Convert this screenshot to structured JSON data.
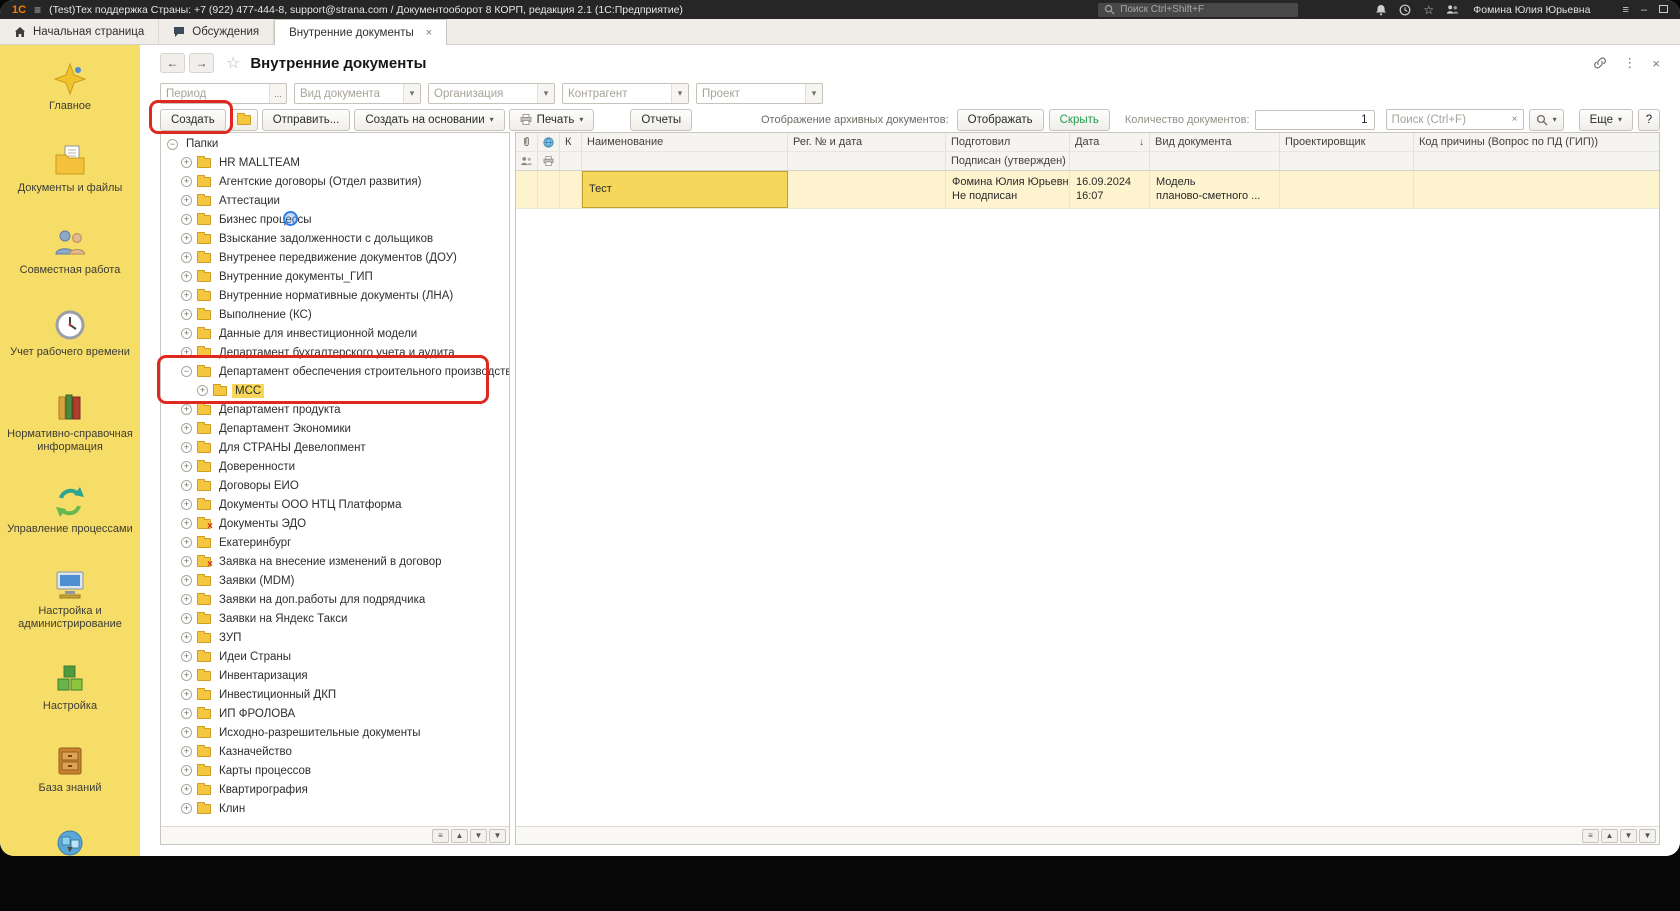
{
  "colors": {
    "annotation_red": "#E0281E",
    "selection_yellow": "#F6D75C",
    "row_highlight": "#FDF3CE",
    "hide_button_green": "#1E9E4B",
    "sidebar_gold": "#F6DD68"
  },
  "titlebar": {
    "logo": "1С",
    "title": "(Test)Тех поддержка Страны: +7 (922) 477-444-8, support@strana.com / Документооборот 8 КОРП, редакция 2.1  (1С:Предприятие)",
    "search_placeholder": "Поиск Ctrl+Shift+F",
    "user_name": "Фомина Юлия Юрьевна",
    "minimize": "–",
    "menu_glyph": "≡"
  },
  "tabbar": {
    "tabs": [
      {
        "label": "Начальная страница",
        "icon": "home-icon",
        "active": false
      },
      {
        "label": "Обсуждения",
        "icon": "chat-icon",
        "active": false
      },
      {
        "label": "Внутренние документы",
        "icon": null,
        "active": true,
        "close": "×"
      }
    ]
  },
  "sidebar": {
    "items": [
      {
        "label": "Главное",
        "icon": "main-icon"
      },
      {
        "label": "Документы и файлы",
        "icon": "documents-icon"
      },
      {
        "label": "Совместная работа",
        "icon": "collaboration-icon"
      },
      {
        "label": "Учет рабочего времени",
        "icon": "time-tracking-icon"
      },
      {
        "label": "Нормативно-справочная информация",
        "icon": "reference-info-icon"
      },
      {
        "label": "Управление процессами",
        "icon": "process-management-icon"
      },
      {
        "label": "Настройка и администрирование",
        "icon": "administration-icon"
      },
      {
        "label": "Настройка",
        "icon": "settings-icon"
      },
      {
        "label": "База знаний",
        "icon": "knowledge-base-icon"
      }
    ],
    "more_glyph": "▼"
  },
  "page": {
    "title": "Внутренние документы",
    "back_glyph": "←",
    "forward_glyph": "→",
    "star_glyph": "☆",
    "kebab_glyph": "⋮",
    "close_glyph": "×",
    "filters": {
      "period_placeholder": "Период",
      "period_button": "...",
      "doc_kind_placeholder": "Вид документа",
      "organization_placeholder": "Организация",
      "counterparty_placeholder": "Контрагент",
      "project_placeholder": "Проект",
      "dropdown_glyph": "▾"
    },
    "toolbar": {
      "create": "Создать",
      "send": "Отправить...",
      "create_based_on": "Создать на основании",
      "print": "Печать",
      "reports": "Отчеты",
      "caret": "▾",
      "archive_display_label": "Отображение архивных документов:",
      "show": "Отображать",
      "hide": "Скрыть",
      "doc_count_label": "Количество документов:",
      "doc_count_value": "1",
      "search_placeholder": "Поиск (Ctrl+F)",
      "clear_glyph": "×",
      "more": "Еще",
      "help": "?"
    }
  },
  "tree": {
    "root_label": "Папки",
    "root_expander": "−",
    "items": [
      {
        "label": "HR MALLTEAM",
        "exp": "+",
        "level": 1,
        "icon": "folder"
      },
      {
        "label": "Агентские договоры (Отдел развития)",
        "exp": "+",
        "level": 1,
        "icon": "folder"
      },
      {
        "label": "Аттестации",
        "exp": "+",
        "level": 1,
        "icon": "folder"
      },
      {
        "label": "Бизнес процессы",
        "exp": "+",
        "level": 1,
        "icon": "folder"
      },
      {
        "label": "Взыскание задолженности с дольщиков",
        "exp": "+",
        "level": 1,
        "icon": "folder"
      },
      {
        "label": "Внутренее передвижение документов (ДОУ)",
        "exp": "+",
        "level": 1,
        "icon": "folder"
      },
      {
        "label": "Внутренние документы_ГИП",
        "exp": "+",
        "level": 1,
        "icon": "folder"
      },
      {
        "label": "Внутренние нормативные документы (ЛНА)",
        "exp": "+",
        "level": 1,
        "icon": "folder"
      },
      {
        "label": "Выполнение (КС)",
        "exp": "+",
        "level": 1,
        "icon": "folder"
      },
      {
        "label": "Данные для инвестиционной модели",
        "exp": "+",
        "level": 1,
        "icon": "folder"
      },
      {
        "label": "Департамент бухгалтерского учета и аудита",
        "exp": "+",
        "level": 1,
        "icon": "folder"
      },
      {
        "label": "Департамент обеспечения строительного производства",
        "exp": "−",
        "level": 1,
        "icon": "folder"
      },
      {
        "label": "МСС",
        "exp": "+",
        "level": 2,
        "icon": "folder",
        "selected": true
      },
      {
        "label": "Департамент продукта",
        "exp": "+",
        "level": 1,
        "icon": "folder"
      },
      {
        "label": "Департамент Экономики",
        "exp": "+",
        "level": 1,
        "icon": "folder"
      },
      {
        "label": "Для СТРАНЫ Девелопмент",
        "exp": "+",
        "level": 1,
        "icon": "folder"
      },
      {
        "label": "Доверенности",
        "exp": "+",
        "level": 1,
        "icon": "folder"
      },
      {
        "label": "Договоры ЕИО",
        "exp": "+",
        "level": 1,
        "icon": "folder"
      },
      {
        "label": "Документы ООО НТЦ Платформа",
        "exp": "+",
        "level": 1,
        "icon": "folder"
      },
      {
        "label": "Документы ЭДО",
        "exp": "+",
        "level": 1,
        "icon": "folder-x"
      },
      {
        "label": "Екатеринбург",
        "exp": "+",
        "level": 1,
        "icon": "folder"
      },
      {
        "label": "Заявка на внесение изменений в договор",
        "exp": "+",
        "level": 1,
        "icon": "folder-x"
      },
      {
        "label": "Заявки (MDM)",
        "exp": "+",
        "level": 1,
        "icon": "folder"
      },
      {
        "label": "Заявки на доп.работы для подрядчика",
        "exp": "+",
        "level": 1,
        "icon": "folder"
      },
      {
        "label": "Заявки на Яндекс Такси",
        "exp": "+",
        "level": 1,
        "icon": "folder"
      },
      {
        "label": "ЗУП",
        "exp": "+",
        "level": 1,
        "icon": "folder"
      },
      {
        "label": "Идеи Страны",
        "exp": "+",
        "level": 1,
        "icon": "folder"
      },
      {
        "label": "Инвентаризация",
        "exp": "+",
        "level": 1,
        "icon": "folder"
      },
      {
        "label": "Инвестиционный ДКП",
        "exp": "+",
        "level": 1,
        "icon": "folder"
      },
      {
        "label": "ИП ФРОЛОВА",
        "exp": "+",
        "level": 1,
        "icon": "folder"
      },
      {
        "label": "Исходно-разрешительные документы",
        "exp": "+",
        "level": 1,
        "icon": "folder"
      },
      {
        "label": "Казначейство",
        "exp": "+",
        "level": 1,
        "icon": "folder"
      },
      {
        "label": "Карты процессов",
        "exp": "+",
        "level": 1,
        "icon": "folder"
      },
      {
        "label": "Квартирография",
        "exp": "+",
        "level": 1,
        "icon": "folder"
      },
      {
        "label": "Клин",
        "exp": "+",
        "level": 1,
        "icon": "folder"
      }
    ]
  },
  "table": {
    "header_row1": {
      "k": "К",
      "name": "Наименование",
      "reg": "Рег. № и дата",
      "prepared": "Подготовил",
      "date": "Дата",
      "sort": "↓",
      "doc_kind": "Вид документа",
      "designer": "Проектировщик",
      "reason_code": "Код причины  (Вопрос по ПД (ГИП))"
    },
    "header_row2": {
      "signed": "Подписан (утвержден)"
    },
    "row": {
      "name": "Тест",
      "prepared": "Фомина Юлия Юрьевна",
      "signed": "Не подписан",
      "date": "16.09.2024",
      "time": "16:07",
      "doc_kind_line1": "Модель",
      "doc_kind_line2": "планово-сметного ..."
    }
  },
  "panel_nav": [
    "≡",
    "▲",
    "▼",
    "▼"
  ]
}
